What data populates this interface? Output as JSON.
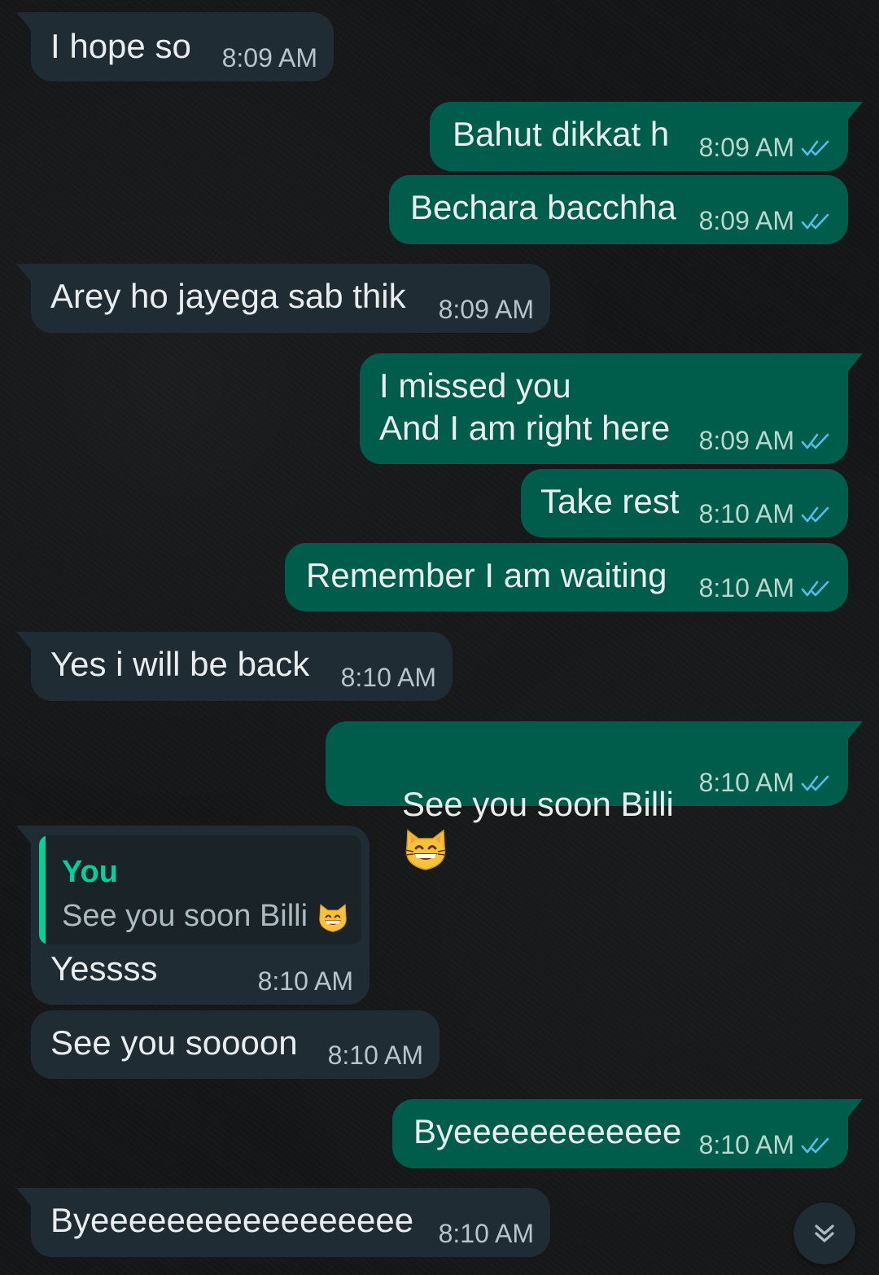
{
  "messages": [
    {
      "text": "I hope so",
      "time": "8:09 AM"
    },
    {
      "text": "Bahut dikkat h",
      "time": "8:09 AM"
    },
    {
      "text": "Bechara bacchha",
      "time": "8:09 AM"
    },
    {
      "text": "Arey ho jayega sab thik",
      "time": "8:09 AM"
    },
    {
      "text": "I missed you\nAnd I am right here",
      "time": "8:09 AM"
    },
    {
      "text": "Take rest",
      "time": "8:10 AM"
    },
    {
      "text": "Remember I am waiting",
      "time": "8:10 AM"
    },
    {
      "text": "Yes i will be back",
      "time": "8:10 AM"
    },
    {
      "text": "See you soon Billi",
      "time": "8:10 AM"
    },
    {
      "text": "Yessss",
      "time": "8:10 AM",
      "reply": {
        "author": "You",
        "text": "See you soon Billi"
      }
    },
    {
      "text": "See you soooon",
      "time": "8:10 AM"
    },
    {
      "text": "Byeeeeeeeeeeee",
      "time": "8:10 AM"
    },
    {
      "text": "Byeeeeeeeeeeeeeeeee",
      "time": "8:10 AM"
    }
  ],
  "colors": {
    "incoming_bubble": "#202c33",
    "outgoing_bubble": "#005c4b",
    "read_ticks": "#53bdeb",
    "quote_accent": "#06cf9c"
  },
  "icons": {
    "read_receipt": "double-check-icon",
    "emoji": "grinning-cat-emoji",
    "scroll_down": "double-chevron-down-icon"
  }
}
